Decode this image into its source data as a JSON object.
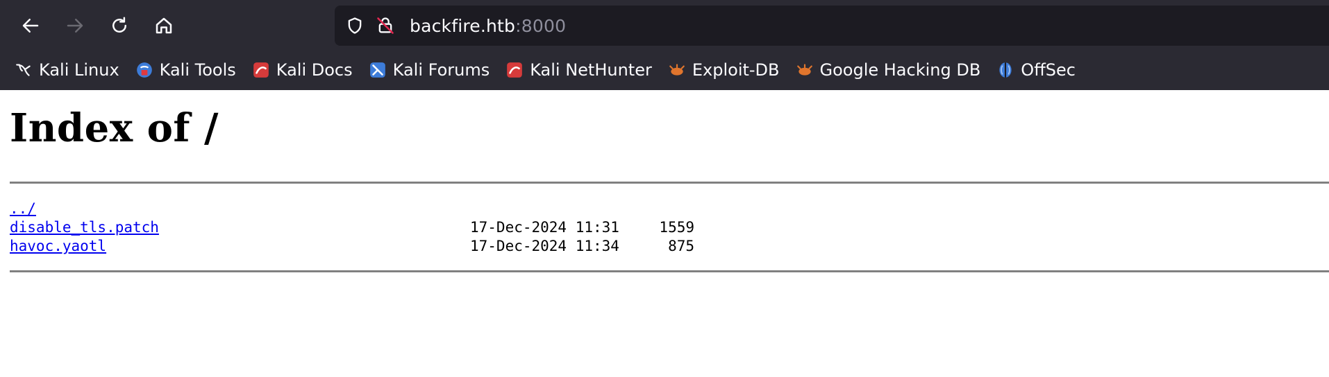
{
  "browser": {
    "url_host": "backfire.htb",
    "url_port": ":8000",
    "bookmarks": [
      {
        "label": "Kali Linux",
        "icon": "kali-dragon-icon"
      },
      {
        "label": "Kali Tools",
        "icon": "kali-tools-icon"
      },
      {
        "label": "Kali Docs",
        "icon": "kali-docs-icon"
      },
      {
        "label": "Kali Forums",
        "icon": "kali-forums-icon"
      },
      {
        "label": "Kali NetHunter",
        "icon": "kali-nethunter-icon"
      },
      {
        "label": "Exploit-DB",
        "icon": "exploit-db-icon"
      },
      {
        "label": "Google Hacking DB",
        "icon": "ghdb-icon"
      },
      {
        "label": "OffSec",
        "icon": "offsec-icon"
      }
    ]
  },
  "page": {
    "title": "Index of /",
    "entries": [
      {
        "name": "../",
        "date": "",
        "size": ""
      },
      {
        "name": "disable_tls.patch",
        "date": "17-Dec-2024 11:31",
        "size": "1559"
      },
      {
        "name": "havoc.yaotl",
        "date": "17-Dec-2024 11:34",
        "size": "875"
      }
    ]
  },
  "colors": {
    "chrome_bg": "#2b2a33",
    "urlbar_bg": "#1c1b22",
    "link": "#0000ee"
  }
}
